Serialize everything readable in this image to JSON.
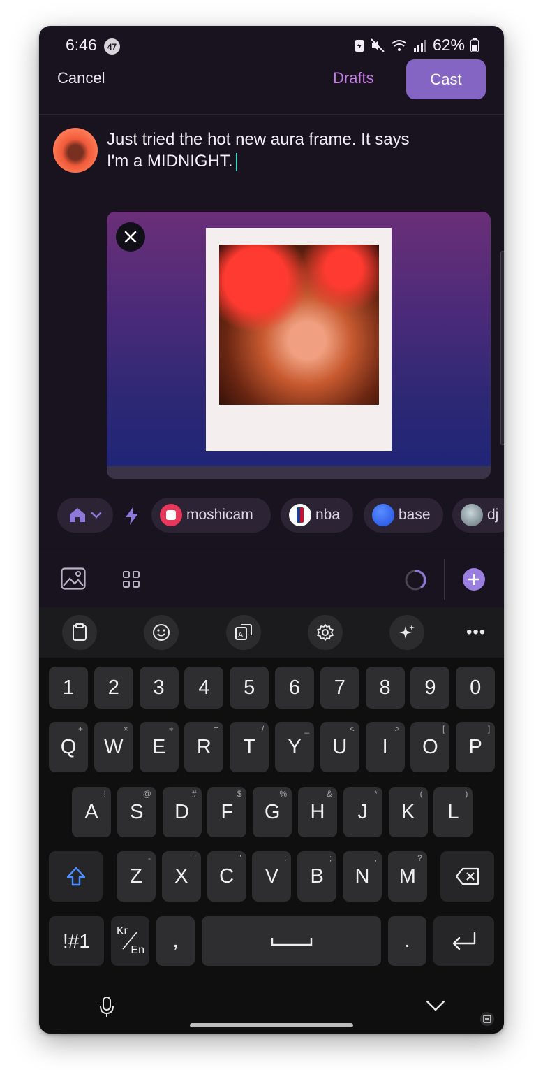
{
  "status_bar": {
    "time": "6:46",
    "notification_count": "47",
    "battery": "62%"
  },
  "header": {
    "cancel": "Cancel",
    "drafts": "Drafts",
    "cast": "Cast"
  },
  "compose": {
    "text_line1": "Just tried the hot new aura frame. It says",
    "text_line2": "I'm a MIDNIGHT."
  },
  "channels": [
    {
      "label": "moshicam",
      "icon": "moshicam-logo-icon",
      "color": "#e8375a"
    },
    {
      "label": "nba",
      "icon": "nba-logo-icon",
      "color": "#ffffff"
    },
    {
      "label": "base",
      "icon": "base-logo-icon",
      "color": "#1f5bf0"
    },
    {
      "label": "dj",
      "icon": "globe-logo-icon",
      "color": "#8aa0a8"
    }
  ],
  "keyboard": {
    "numbers": [
      "1",
      "2",
      "3",
      "4",
      "5",
      "6",
      "7",
      "8",
      "9",
      "0"
    ],
    "row1": [
      {
        "k": "Q",
        "s": "+"
      },
      {
        "k": "W",
        "s": "×"
      },
      {
        "k": "E",
        "s": "÷"
      },
      {
        "k": "R",
        "s": "="
      },
      {
        "k": "T",
        "s": "/"
      },
      {
        "k": "Y",
        "s": "_"
      },
      {
        "k": "U",
        "s": "<"
      },
      {
        "k": "I",
        "s": ">"
      },
      {
        "k": "O",
        "s": "["
      },
      {
        "k": "P",
        "s": "]"
      }
    ],
    "row2": [
      {
        "k": "A",
        "s": "!"
      },
      {
        "k": "S",
        "s": "@"
      },
      {
        "k": "D",
        "s": "#"
      },
      {
        "k": "F",
        "s": "$"
      },
      {
        "k": "G",
        "s": "%"
      },
      {
        "k": "H",
        "s": "&"
      },
      {
        "k": "J",
        "s": "*"
      },
      {
        "k": "K",
        "s": "("
      },
      {
        "k": "L",
        "s": ")"
      }
    ],
    "row3": [
      {
        "k": "Z",
        "s": "-"
      },
      {
        "k": "X",
        "s": "'"
      },
      {
        "k": "C",
        "s": "\""
      },
      {
        "k": "V",
        "s": ":"
      },
      {
        "k": "B",
        "s": ";"
      },
      {
        "k": "N",
        "s": ","
      },
      {
        "k": "M",
        "s": "?"
      }
    ],
    "symbols": "!#1",
    "lang_top": "Kr",
    "lang_bottom": "En",
    "comma": ",",
    "period": "."
  },
  "colors": {
    "accent": "#8565c4",
    "drafts": "#c77fe8",
    "background": "#19121f"
  }
}
